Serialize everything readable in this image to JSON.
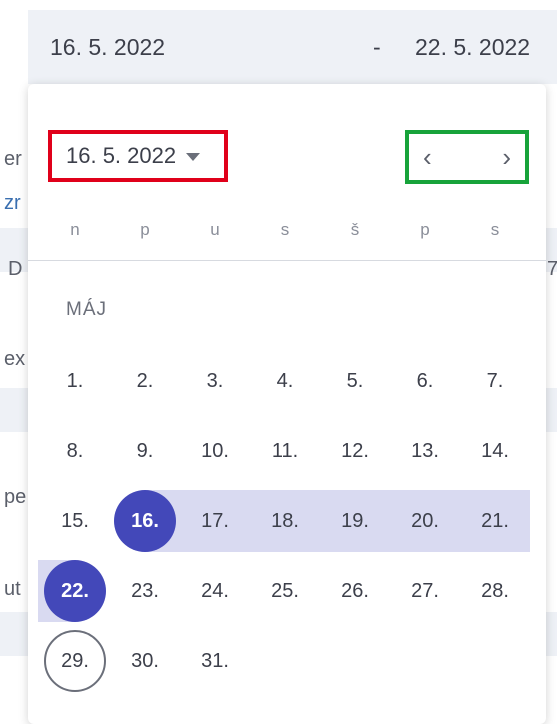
{
  "range": {
    "start": "16. 5. 2022",
    "separator": "-",
    "end": "22. 5. 2022"
  },
  "background": [
    "er",
    "zr",
    "D",
    "ex",
    "pe",
    "ut",
    "7"
  ],
  "calendar": {
    "month_select": "16. 5. 2022",
    "prev_icon": "‹",
    "next_icon": "›",
    "weekdays": [
      "n",
      "p",
      "u",
      "s",
      "š",
      "p",
      "s"
    ],
    "month_label": "MÁJ",
    "weeks": [
      [
        "1.",
        "2.",
        "3.",
        "4.",
        "5.",
        "6.",
        "7."
      ],
      [
        "8.",
        "9.",
        "10.",
        "11.",
        "12.",
        "13.",
        "14."
      ],
      [
        "15.",
        "16.",
        "17.",
        "18.",
        "19.",
        "20.",
        "21."
      ],
      [
        "22.",
        "23.",
        "24.",
        "25.",
        "26.",
        "27.",
        "28."
      ],
      [
        "29.",
        "30.",
        "31."
      ]
    ],
    "selected_start": "16.",
    "selected_end": "22.",
    "today": "29."
  },
  "colors": {
    "selected": "#4348b9",
    "range_band": "#d9daf1",
    "month_highlight": "#e0001a",
    "nav_highlight": "#17a33a"
  }
}
